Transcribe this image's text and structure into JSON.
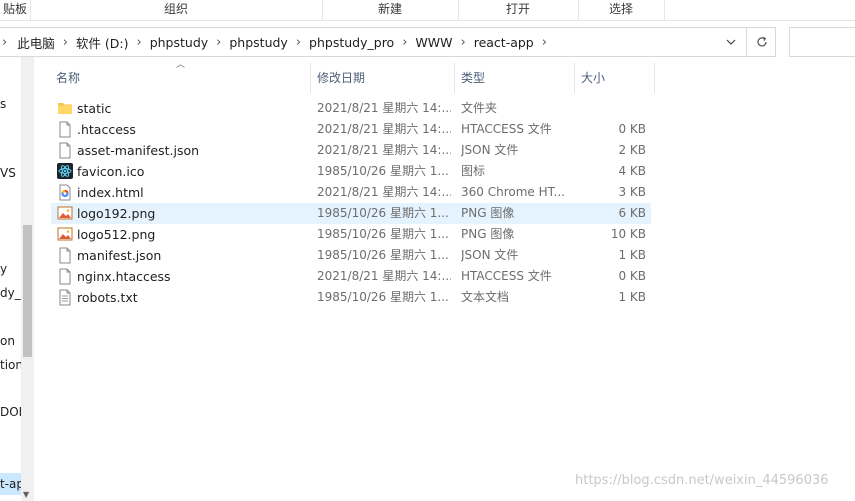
{
  "ribbon": {
    "groups": [
      "贴板",
      "组织",
      "新建",
      "打开",
      "选择"
    ]
  },
  "address": {
    "crumbs": [
      "此电脑",
      "软件 (D:)",
      "phpstudy",
      "phpstudy",
      "phpstudy_pro",
      "WWW",
      "react-app"
    ],
    "refresh_icon": "refresh-icon",
    "dropdown_icon": "chevron-down-icon"
  },
  "nav": {
    "items": [
      "s",
      "VS",
      "y",
      "dy_p",
      "on",
      "tion",
      "DON",
      "t-ap"
    ],
    "selected_item": "t-ap"
  },
  "columns": {
    "name": "名称",
    "modified": "修改日期",
    "type": "类型",
    "size": "大小"
  },
  "files": [
    {
      "name": "static",
      "modified": "2021/8/21 星期六 14:...",
      "type": "文件夹",
      "size": "",
      "icon": "folder-icon"
    },
    {
      "name": ".htaccess",
      "modified": "2021/8/21 星期六 14:...",
      "type": "HTACCESS 文件",
      "size": "0 KB",
      "icon": "file-icon"
    },
    {
      "name": "asset-manifest.json",
      "modified": "2021/8/21 星期六 14:...",
      "type": "JSON 文件",
      "size": "2 KB",
      "icon": "file-icon"
    },
    {
      "name": "favicon.ico",
      "modified": "1985/10/26 星期六 1...",
      "type": "图标",
      "size": "4 KB",
      "icon": "react-icon"
    },
    {
      "name": "index.html",
      "modified": "2021/8/21 星期六 14:...",
      "type": "360 Chrome HT...",
      "size": "3 KB",
      "icon": "browser-icon"
    },
    {
      "name": "logo192.png",
      "modified": "1985/10/26 星期六 1...",
      "type": "PNG 图像",
      "size": "6 KB",
      "icon": "image-icon"
    },
    {
      "name": "logo512.png",
      "modified": "1985/10/26 星期六 1...",
      "type": "PNG 图像",
      "size": "10 KB",
      "icon": "image-icon"
    },
    {
      "name": "manifest.json",
      "modified": "1985/10/26 星期六 1...",
      "type": "JSON 文件",
      "size": "1 KB",
      "icon": "file-icon"
    },
    {
      "name": "nginx.htaccess",
      "modified": "2021/8/21 星期六 14:...",
      "type": "HTACCESS 文件",
      "size": "0 KB",
      "icon": "file-icon"
    },
    {
      "name": "robots.txt",
      "modified": "1985/10/26 星期六 1...",
      "type": "文本文档",
      "size": "1 KB",
      "icon": "text-file-icon"
    }
  ],
  "hovered_file": "logo192.png",
  "watermark": "https://blog.csdn.net/weixin_44596036",
  "colors": {
    "hover_row": "#e5f3ff",
    "header_text": "#4c607a",
    "folder": "#f6c54b"
  }
}
